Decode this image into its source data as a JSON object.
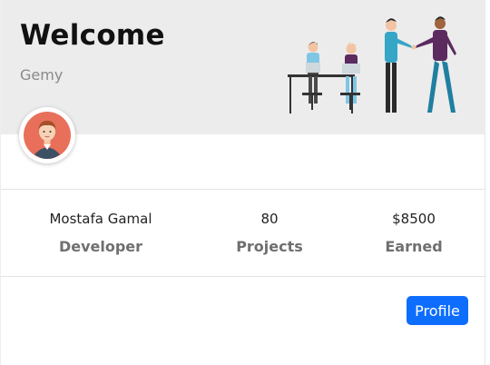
{
  "header": {
    "title": "Welcome",
    "subtitle": "Gemy",
    "background_color": "#ececec",
    "illustration": "team-meeting-handshake-illustration"
  },
  "profile": {
    "avatar_icon": "user-avatar-icon"
  },
  "stats": [
    {
      "value": "Mostafa Gamal",
      "label": "Developer"
    },
    {
      "value": "80",
      "label": "Projects"
    },
    {
      "value": "$8500",
      "label": "Earned"
    }
  ],
  "actions": {
    "profile_label": "Profile",
    "accent_color": "#0d6efd"
  }
}
